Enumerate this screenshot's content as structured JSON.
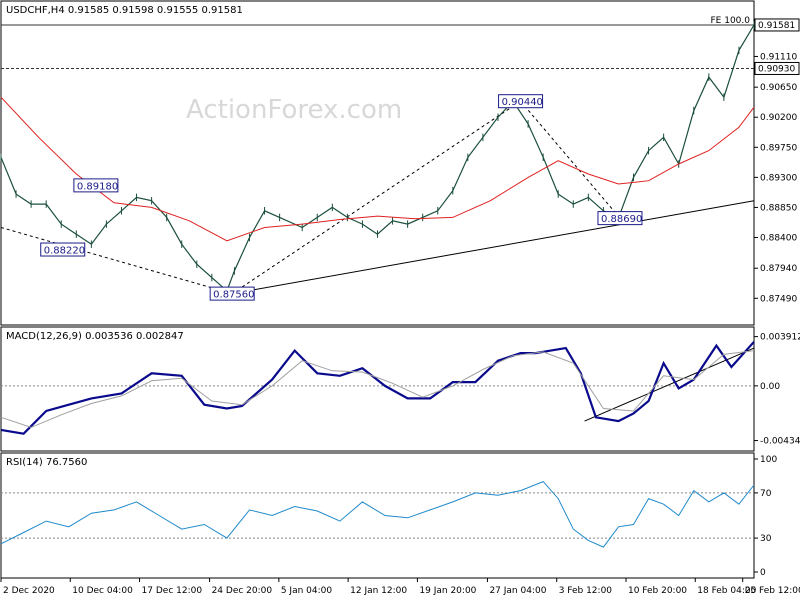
{
  "chart_data": [
    {
      "type": "line",
      "panel": "price",
      "header": "USDCHF,H4  0.91585 0.91598 0.91555 0.91581",
      "watermark": "ActionForex.com",
      "ylim": [
        0.8718,
        0.9185
      ],
      "y_ticks": [
        "0.91110",
        "0.90650",
        "0.90200",
        "0.89750",
        "0.89300",
        "0.88850",
        "0.88400",
        "0.87940",
        "0.87490"
      ],
      "y_tick_values": [
        0.9111,
        0.9065,
        0.902,
        0.8975,
        0.893,
        0.8885,
        0.884,
        0.8794,
        0.8749
      ],
      "current_price_label": "0.91581",
      "fe_label": "FE 100.0",
      "fe_level": 0.91581,
      "hline_label": "0.90930",
      "hline_level": 0.9093,
      "annotations": [
        {
          "text": "0.88220",
          "x": 0.082,
          "y": 0.8822
        },
        {
          "text": "0.89180",
          "x": 0.126,
          "y": 0.8918
        },
        {
          "text": "0.87560",
          "x": 0.307,
          "y": 0.8756
        },
        {
          "text": "0.90440",
          "x": 0.69,
          "y": 0.9044
        },
        {
          "text": "0.88690",
          "x": 0.822,
          "y": 0.8869
        }
      ],
      "series": [
        {
          "name": "Price",
          "color": "#1a4f3a",
          "x": [
            0,
            0.02,
            0.04,
            0.06,
            0.08,
            0.1,
            0.12,
            0.14,
            0.16,
            0.18,
            0.2,
            0.22,
            0.24,
            0.26,
            0.28,
            0.3,
            0.31,
            0.33,
            0.35,
            0.37,
            0.4,
            0.42,
            0.44,
            0.46,
            0.48,
            0.5,
            0.52,
            0.54,
            0.56,
            0.58,
            0.6,
            0.62,
            0.64,
            0.66,
            0.68,
            0.7,
            0.72,
            0.74,
            0.76,
            0.78,
            0.8,
            0.82,
            0.84,
            0.86,
            0.88,
            0.9,
            0.92,
            0.94,
            0.96,
            0.98,
            1.0
          ],
          "values": [
            0.896,
            0.8905,
            0.889,
            0.889,
            0.886,
            0.8845,
            0.883,
            0.886,
            0.888,
            0.89,
            0.8895,
            0.887,
            0.883,
            0.88,
            0.878,
            0.876,
            0.879,
            0.884,
            0.888,
            0.887,
            0.8855,
            0.887,
            0.8885,
            0.887,
            0.886,
            0.8845,
            0.8865,
            0.886,
            0.887,
            0.888,
            0.891,
            0.896,
            0.899,
            0.902,
            0.9044,
            0.901,
            0.896,
            0.8905,
            0.889,
            0.89,
            0.888,
            0.8869,
            0.893,
            0.897,
            0.899,
            0.895,
            0.903,
            0.908,
            0.905,
            0.912,
            0.9158
          ]
        },
        {
          "name": "MA",
          "color": "#e02020",
          "x": [
            0,
            0.05,
            0.1,
            0.15,
            0.2,
            0.25,
            0.3,
            0.35,
            0.4,
            0.45,
            0.5,
            0.55,
            0.6,
            0.65,
            0.7,
            0.74,
            0.78,
            0.82,
            0.86,
            0.9,
            0.94,
            0.98,
            1.0
          ],
          "values": [
            0.905,
            0.899,
            0.8935,
            0.8892,
            0.8885,
            0.8865,
            0.8835,
            0.8855,
            0.886,
            0.8867,
            0.8872,
            0.8868,
            0.887,
            0.8895,
            0.893,
            0.8955,
            0.8935,
            0.892,
            0.8925,
            0.895,
            0.897,
            0.9005,
            0.9035
          ]
        }
      ],
      "trendlines": [
        {
          "name": "support",
          "x": [
            0.307,
            1.0
          ],
          "y": [
            0.8756,
            0.8895
          ],
          "style": "solid"
        },
        {
          "name": "falling",
          "x": [
            0.0,
            0.307
          ],
          "y": [
            0.8855,
            0.8756
          ],
          "style": "dashed"
        },
        {
          "name": "rising",
          "x": [
            0.307,
            0.69
          ],
          "y": [
            0.8756,
            0.9044
          ],
          "style": "dashed"
        },
        {
          "name": "down-leg",
          "x": [
            0.69,
            0.822
          ],
          "y": [
            0.9044,
            0.8869
          ],
          "style": "dashed"
        }
      ]
    },
    {
      "type": "line",
      "panel": "macd",
      "header": "MACD(12,26,9) 0.003536 0.002847",
      "ylim": [
        -0.0047,
        0.0042
      ],
      "y_ticks": [
        "0.003912",
        "0.00",
        "-0.004347"
      ],
      "y_tick_values": [
        0.003912,
        0.0,
        -0.004347
      ],
      "series": [
        {
          "name": "MACD",
          "color": "#0a0a8c",
          "x": [
            0,
            0.03,
            0.06,
            0.09,
            0.12,
            0.16,
            0.2,
            0.24,
            0.27,
            0.3,
            0.32,
            0.36,
            0.39,
            0.42,
            0.45,
            0.48,
            0.51,
            0.54,
            0.57,
            0.6,
            0.63,
            0.66,
            0.69,
            0.71,
            0.73,
            0.75,
            0.77,
            0.79,
            0.82,
            0.84,
            0.86,
            0.88,
            0.9,
            0.92,
            0.95,
            0.97,
            1.0
          ],
          "values": [
            -0.0035,
            -0.0038,
            -0.002,
            -0.0015,
            -0.001,
            -0.0006,
            0.001,
            0.0008,
            -0.0015,
            -0.0018,
            -0.0016,
            0.0005,
            0.0028,
            0.001,
            0.0008,
            0.0014,
            0.0,
            -0.001,
            -0.001,
            0.0003,
            0.0003,
            0.002,
            0.0026,
            0.0026,
            0.0028,
            0.003,
            0.001,
            -0.0025,
            -0.0028,
            -0.0022,
            -0.0012,
            0.0018,
            -0.0002,
            0.0005,
            0.0032,
            0.0015,
            0.0035
          ]
        },
        {
          "name": "Signal",
          "color": "#a0a0a0",
          "x": [
            0,
            0.04,
            0.08,
            0.12,
            0.16,
            0.2,
            0.24,
            0.28,
            0.32,
            0.36,
            0.4,
            0.44,
            0.48,
            0.52,
            0.56,
            0.6,
            0.64,
            0.68,
            0.72,
            0.76,
            0.8,
            0.84,
            0.88,
            0.92,
            0.96,
            1.0
          ],
          "values": [
            -0.0025,
            -0.0033,
            -0.0023,
            -0.0014,
            -0.0008,
            0.0004,
            0.0006,
            -0.0012,
            -0.0015,
            0.0,
            0.002,
            0.0012,
            0.0011,
            0.0002,
            -0.0009,
            0.0,
            0.0013,
            0.0024,
            0.0027,
            0.0018,
            -0.0018,
            -0.002,
            0.0008,
            0.0005,
            0.0025,
            0.0028
          ]
        }
      ],
      "trendlines": [
        {
          "name": "macd-support",
          "x": [
            0.775,
            1.0
          ],
          "y": [
            -0.0028,
            0.003
          ],
          "style": "solid"
        }
      ]
    },
    {
      "type": "line",
      "panel": "rsi",
      "header": "RSI(14) 76.7560",
      "ylim": [
        0,
        100
      ],
      "y_ticks": [
        "100",
        "70",
        "30",
        "0"
      ],
      "y_tick_values": [
        100,
        70,
        30,
        0
      ],
      "levels": [
        70,
        30
      ],
      "series": [
        {
          "name": "RSI",
          "color": "#1f8acb",
          "x": [
            0,
            0.03,
            0.06,
            0.09,
            0.12,
            0.15,
            0.18,
            0.21,
            0.24,
            0.27,
            0.3,
            0.33,
            0.36,
            0.39,
            0.42,
            0.45,
            0.48,
            0.51,
            0.54,
            0.57,
            0.6,
            0.63,
            0.66,
            0.69,
            0.72,
            0.74,
            0.76,
            0.78,
            0.8,
            0.82,
            0.84,
            0.86,
            0.88,
            0.9,
            0.92,
            0.94,
            0.96,
            0.98,
            1.0
          ],
          "values": [
            25,
            35,
            45,
            40,
            52,
            55,
            62,
            50,
            38,
            42,
            30,
            55,
            50,
            58,
            54,
            45,
            62,
            50,
            48,
            55,
            62,
            70,
            68,
            72,
            80,
            65,
            38,
            28,
            22,
            40,
            42,
            65,
            60,
            50,
            72,
            62,
            70,
            60,
            77
          ]
        }
      ]
    }
  ],
  "x_axis": {
    "ticks": [
      "2 Dec 2020",
      "10 Dec 04:00",
      "17 Dec 12:00",
      "24 Dec 20:00",
      "5 Jan 04:00",
      "12 Jan 12:00",
      "19 Jan 20:00",
      "27 Jan 04:00",
      "3 Feb 12:00",
      "10 Feb 20:00",
      "18 Feb 04:00",
      "25 Feb 12:00"
    ],
    "tick_positions": [
      0.0,
      0.092,
      0.184,
      0.277,
      0.369,
      0.461,
      0.553,
      0.646,
      0.738,
      0.83,
      0.922,
      0.985
    ]
  },
  "colors": {
    "price": "#1a4f3a",
    "ma": "#e02020",
    "macd": "#0a0a8c",
    "signal": "#a0a0a0",
    "rsi": "#1f8acb",
    "label": "#1b1b8a"
  }
}
